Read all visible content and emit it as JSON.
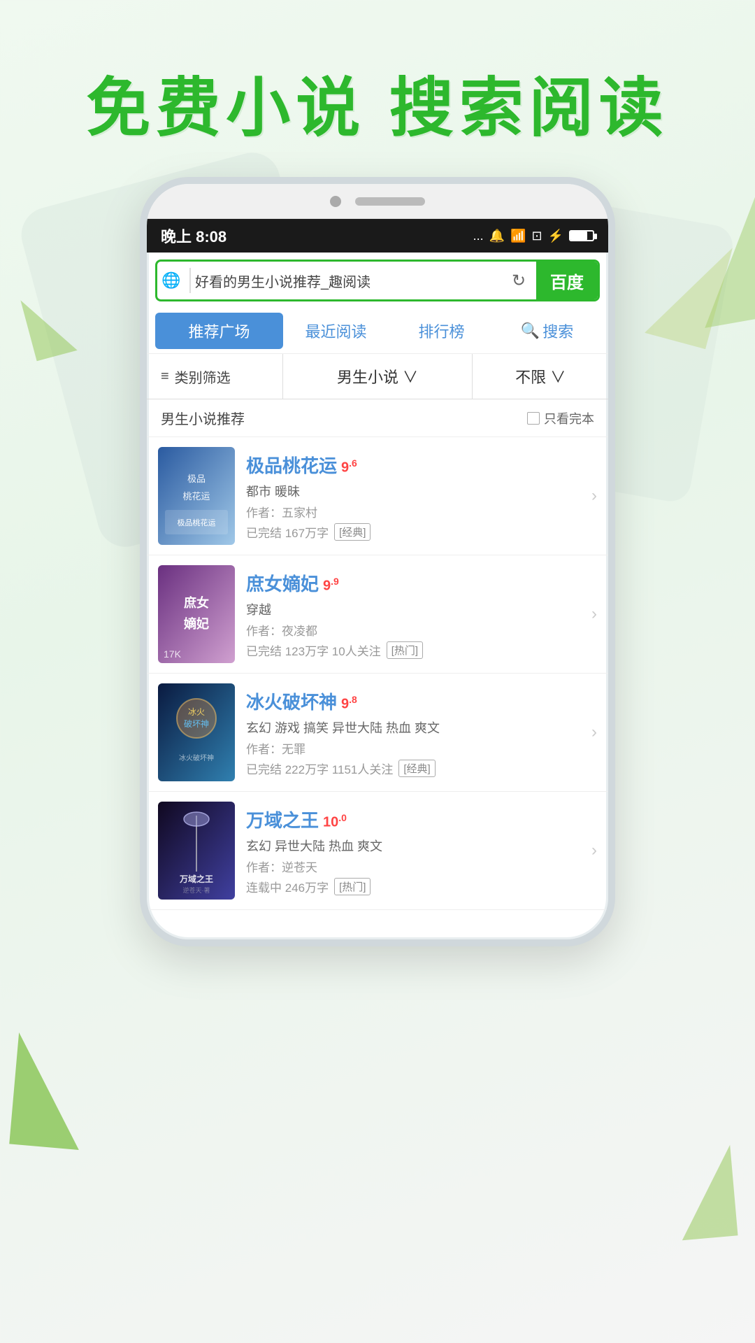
{
  "page": {
    "background_color": "#f0f9f0"
  },
  "header": {
    "title": "免费小说  搜索阅读"
  },
  "phone": {
    "status_bar": {
      "time": "晚上 8:08",
      "icons": "... 🔔 ☁ 📶 ⚡ 🔋"
    },
    "search_bar": {
      "globe_icon": "🌐",
      "query": "好看的男生小说推荐_趣阅读",
      "refresh_icon": "↻",
      "baidu_label": "百度"
    },
    "nav_tabs": [
      {
        "label": "推荐广场",
        "active": true
      },
      {
        "label": "最近阅读",
        "active": false
      },
      {
        "label": "排行榜",
        "active": false
      },
      {
        "label": "🔍搜索",
        "active": false
      }
    ],
    "filters": {
      "category_icon": "≡",
      "category_label": "类别筛选",
      "type_label": "男生小说 ∨",
      "limit_label": "不限 ∨"
    },
    "section": {
      "title": "男生小说推荐",
      "only_complete": "只看完本"
    },
    "books": [
      {
        "id": 1,
        "title": "极品桃花运",
        "rating": "9",
        "rating_decimal": "6",
        "tags": "都市 暖昧",
        "author": "作者：五家村",
        "meta": "已完结 167万字",
        "badge": "经典",
        "cover_style": "cover-1",
        "cover_text": "极品\n桃花运"
      },
      {
        "id": 2,
        "title": "庶女嫡妃",
        "rating": "9",
        "rating_decimal": "9",
        "tags": "穿越",
        "author": "作者：夜凌都",
        "meta": "已完结 123万字 10人关注",
        "badge": "热门",
        "cover_style": "cover-2",
        "cover_text": "庶女嫡妃",
        "watermark": "17K"
      },
      {
        "id": 3,
        "title": "冰火破坏神",
        "rating": "9",
        "rating_decimal": "8",
        "tags": "玄幻 游戏 搞笑 异世大陆 热血 爽文",
        "author": "作者：无罪",
        "meta": "已完结 222万字 1151人关注",
        "badge": "经典",
        "cover_style": "cover-3",
        "cover_text": "冰火破坏神"
      },
      {
        "id": 4,
        "title": "万域之王",
        "rating": "10",
        "rating_decimal": "0",
        "tags": "玄幻 异世大陆 热血 爽文",
        "author": "作者：逆苍天",
        "meta": "连载中 246万字",
        "badge": "热门",
        "cover_style": "cover-4",
        "cover_text": "万域之王"
      }
    ]
  }
}
